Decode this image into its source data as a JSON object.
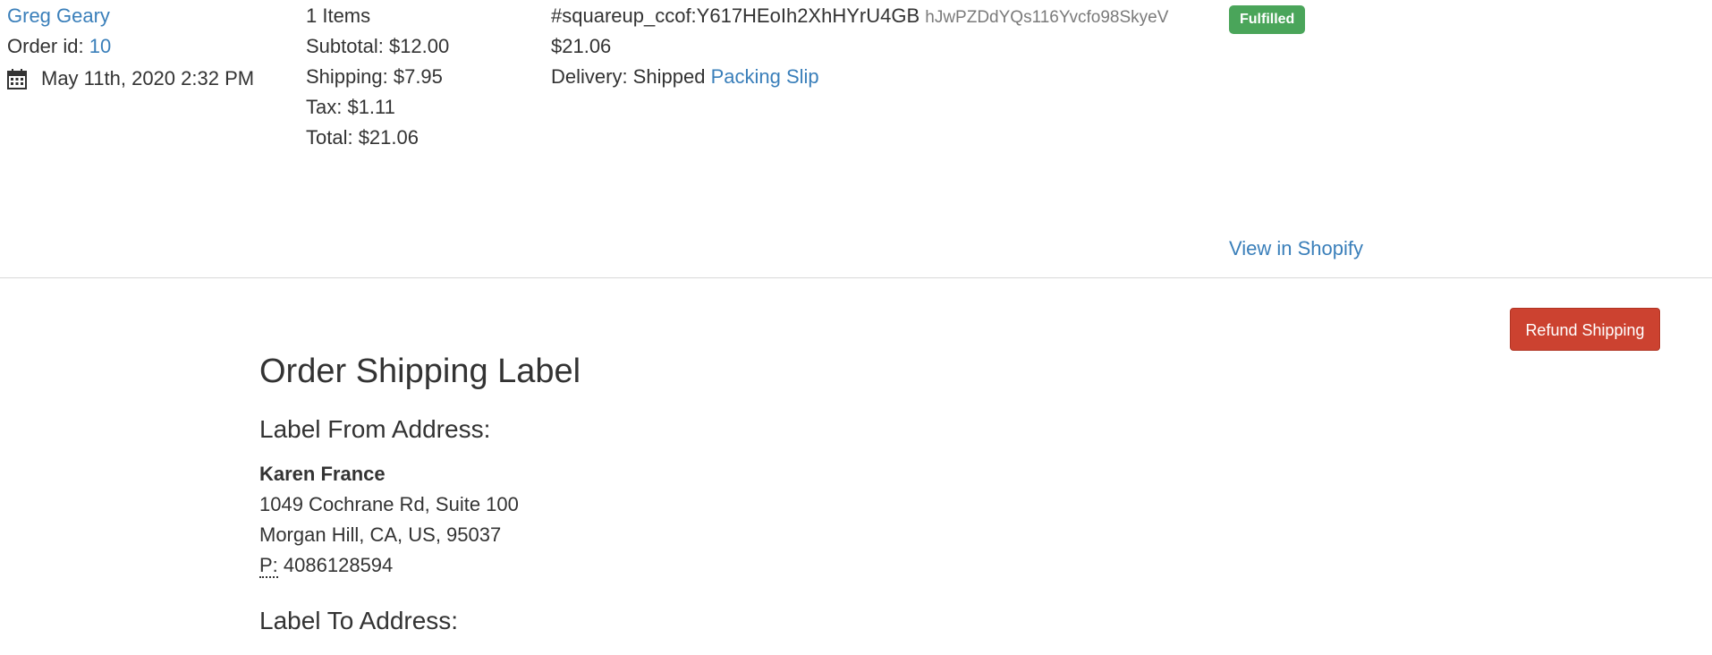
{
  "order": {
    "customer_name": "Greg Geary",
    "order_id_label": "Order id:",
    "order_id": "10",
    "date": "May 11th, 2020 2:32 PM",
    "items": "1 Items",
    "subtotal": "Subtotal: $12.00",
    "shipping": "Shipping: $7.95",
    "tax": "Tax: $1.11",
    "total": "Total: $21.06",
    "payment_ref": "#squareup_ccof:Y617HEoIh2XhHYrU4GB",
    "payment_token": "hJwPZDdYQs116Yvcfo98SkyeV",
    "payment_amount": "$21.06",
    "delivery_label": "Delivery: Shipped",
    "packing_slip": "Packing Slip",
    "status_badge": "Fulfilled",
    "view_in_shopify": "View in Shopify",
    "status_color": "#4aa55a"
  },
  "shipping_label": {
    "refund_button": "Refund Shipping",
    "title": "Order Shipping Label",
    "from_heading": "Label From Address:",
    "from_name": "Karen France",
    "from_line1": "1049 Cochrane Rd, Suite 100",
    "from_line2": "Morgan Hill, CA, US, 95037",
    "phone_label": "P:",
    "phone_number": "4086128594",
    "to_heading": "Label To Address:"
  },
  "colors": {
    "link": "#3a7fba",
    "danger": "#cc4230"
  },
  "icons": {
    "date": "calendar-icon"
  }
}
